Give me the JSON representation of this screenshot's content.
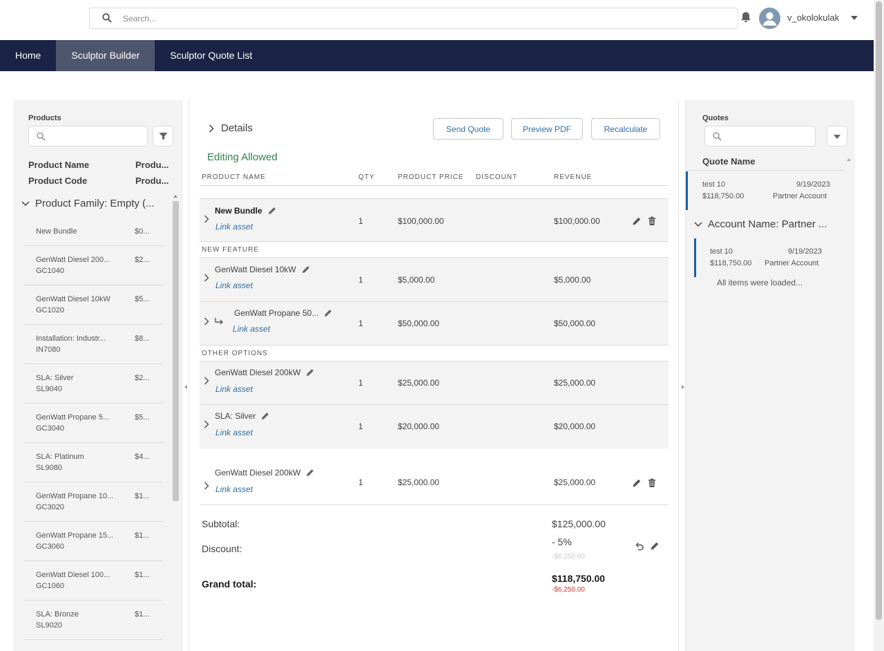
{
  "header": {
    "search_placeholder": "Search...",
    "username": "v_okolokulak"
  },
  "nav": {
    "tabs": [
      {
        "label": "Home",
        "active": false
      },
      {
        "label": "Sculptor Builder",
        "active": true
      },
      {
        "label": "Sculptor Quote List",
        "active": false
      }
    ]
  },
  "products_panel": {
    "title": "Products",
    "columns": {
      "name": "Product Name",
      "code": "Product Code",
      "name2": "Produ...",
      "code2": "Produ..."
    },
    "group_label": "Product Family: Empty (...",
    "items": [
      {
        "name": "New Bundle",
        "price": "$0...",
        "code": ""
      },
      {
        "name": "GenWatt Diesel 200...",
        "price": "$2...",
        "code": "GC1040"
      },
      {
        "name": "GenWatt Diesel 10kW",
        "price": "$5...",
        "code": "GC1020"
      },
      {
        "name": "Installation: Industr...",
        "price": "$8...",
        "code": "IN7080"
      },
      {
        "name": "SLA: Silver",
        "price": "$2...",
        "code": "SL9040"
      },
      {
        "name": "GenWatt Propane 5...",
        "price": "$5...",
        "code": "GC3040"
      },
      {
        "name": "SLA: Platinum",
        "price": "$4...",
        "code": "SL9080"
      },
      {
        "name": "GenWatt Propane 10...",
        "price": "$1...",
        "code": "GC3020"
      },
      {
        "name": "GenWatt Propane 15...",
        "price": "$1...",
        "code": "GC3060"
      },
      {
        "name": "GenWatt Diesel 100...",
        "price": "$1...",
        "code": "GC1060"
      },
      {
        "name": "SLA: Bronze",
        "price": "$1...",
        "code": "SL9020"
      }
    ]
  },
  "builder": {
    "details_label": "Details",
    "buttons": {
      "send": "Send Quote",
      "preview": "Preview PDF",
      "recalc": "Recalculate"
    },
    "status": "Editing Allowed",
    "columns": {
      "name": "PRODUCT NAME",
      "qty": "QTY",
      "price": "PRODUCT PRICE",
      "discount": "DISCOUNT",
      "revenue": "REVENUE"
    },
    "bundle": {
      "name": "New Bundle",
      "link": "Link asset",
      "qty": "1",
      "price": "$100,000.00",
      "revenue": "$100,000.00"
    },
    "sections": {
      "new_feature": "NEW FEATURE",
      "other_options": "OTHER OPTIONS"
    },
    "lines": [
      {
        "name": "GenWatt Diesel 10kW",
        "link": "Link asset",
        "qty": "1",
        "price": "$5,000.00",
        "revenue": "$5,000.00"
      },
      {
        "name": "GenWatt Propane 50...",
        "link": "Link asset",
        "qty": "1",
        "price": "$50,000.00",
        "revenue": "$50,000.00"
      },
      {
        "name": "GenWatt Diesel 200kW",
        "link": "Link asset",
        "qty": "1",
        "price": "$25,000.00",
        "revenue": "$25,000.00"
      },
      {
        "name": "SLA: Silver",
        "link": "Link asset",
        "qty": "1",
        "price": "$20,000.00",
        "revenue": "$20,000.00"
      },
      {
        "name": "GenWatt Diesel 200kW",
        "link": "Link asset",
        "qty": "1",
        "price": "$25,000.00",
        "revenue": "$25,000.00"
      }
    ],
    "totals": {
      "subtotal_label": "Subtotal:",
      "subtotal": "$125,000.00",
      "discount_label": "Discount:",
      "discount_pct": "- 5%",
      "discount_amt": "-$6,250.00",
      "grand_label": "Grand total:",
      "grand": "$118,750.00",
      "grand_diff": "-$6,250.00"
    }
  },
  "quotes_panel": {
    "title": "Quotes",
    "column": "Quote Name",
    "top_card": {
      "name": "test 10",
      "date": "9/19/2023",
      "amount": "$118,750.00",
      "account": "Partner Account"
    },
    "group_label": "Account Name: Partner ...",
    "group_card": {
      "name": "test 10",
      "date": "9/19/2023",
      "amount": "$118,750.00",
      "account": "Partner Account"
    },
    "loaded": "All items were loaded..."
  },
  "colors": {
    "nav_bg": "#1b2447",
    "nav_active": "#4e566e",
    "link": "#2e6ea6",
    "status_green": "#2e844a",
    "accent_blue": "#1b5f9e",
    "negative_red": "#c23934"
  }
}
